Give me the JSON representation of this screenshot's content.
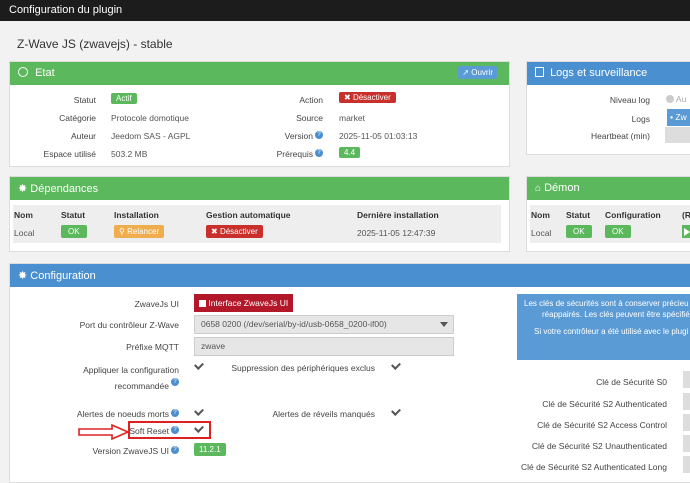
{
  "topbar": {
    "title": "Configuration du plugin"
  },
  "plugin_title": "Z-Wave JS (zwavejs) - stable",
  "etat": {
    "title": "Etat",
    "open_button": "Ouvrir",
    "rows": {
      "statut_label": "Statut",
      "statut_value": "Actif",
      "action_label": "Action",
      "action_value": "Désactiver",
      "categorie_label": "Catégorie",
      "categorie_value": "Protocole domotique",
      "source_label": "Source",
      "source_value": "market",
      "auteur_label": "Auteur",
      "auteur_value": "Jeedom SAS - AGPL",
      "version_label": "Version",
      "version_value": "2025-11-05 01:03:13",
      "espace_label": "Espace utilisé",
      "espace_value": "503.2 MB",
      "prerequis_label": "Prérequis",
      "prerequis_value": "4.4"
    }
  },
  "logs": {
    "title": "Logs et surveillance",
    "niveau_label": "Niveau log",
    "niveau_value": "Au",
    "logs_label": "Logs",
    "logs_value": "Zw",
    "heartbeat_label": "Heartbeat (min)"
  },
  "dependances": {
    "title": "Dépendances",
    "headers": [
      "Nom",
      "Statut",
      "Installation",
      "Gestion automatique",
      "Dernière installation"
    ],
    "row": {
      "nom": "Local",
      "statut": "OK",
      "installation": "Relancer",
      "gestion": "Désactiver",
      "derniere": "2025-11-05 12:47:39"
    }
  },
  "demon": {
    "title": "Démon",
    "headers": [
      "Nom",
      "Statut",
      "Configuration",
      "(R"
    ],
    "row": {
      "nom": "Local",
      "statut": "OK",
      "configuration": "OK"
    }
  },
  "configuration": {
    "title": "Configuration",
    "zwavejs_ui_label": "ZwaveJs UI",
    "zwavejs_ui_button": "Interface ZwaveJs UI",
    "port_label": "Port du contrôleur Z-Wave",
    "port_value": "0658 0200 (/dev/serial/by-id/usb-0658_0200-if00)",
    "prefixe_label": "Préfixe MQTT",
    "prefixe_value": "zwave",
    "appliquer_label_1": "Appliquer la configuration",
    "appliquer_label_2": "recommandée",
    "suppression_label": "Suppression des périphériques exclus",
    "alertes_morts_label": "Alertes de noeuds morts",
    "alertes_reveils_label": "Alertes de réveils manqués",
    "soft_reset_label": "Soft Reset",
    "version_ui_label": "Version ZwaveJS UI",
    "version_ui_value": "11.2.1",
    "info_line1": "Les clés de sécurités sont à conserver précieu",
    "info_line2": "réappairés. Les clés peuvent être spécifiées, s",
    "info_line3": "Si votre contrôleur a été utilisé avec le plugi",
    "keys": [
      "Clé de Sécurité S0",
      "Clé de Sécurité S2 Authenticated",
      "Clé de Sécurité S2 Access Control",
      "Clé de Sécurité S2 Unauthenticated",
      "Clé de Sécurité S2 Authenticated Long"
    ]
  },
  "colors": {
    "green": "#5cb85c",
    "blue": "#4a90d0",
    "red": "#c9302c",
    "orange": "#f0ad4e",
    "annotation": "#e02020"
  }
}
